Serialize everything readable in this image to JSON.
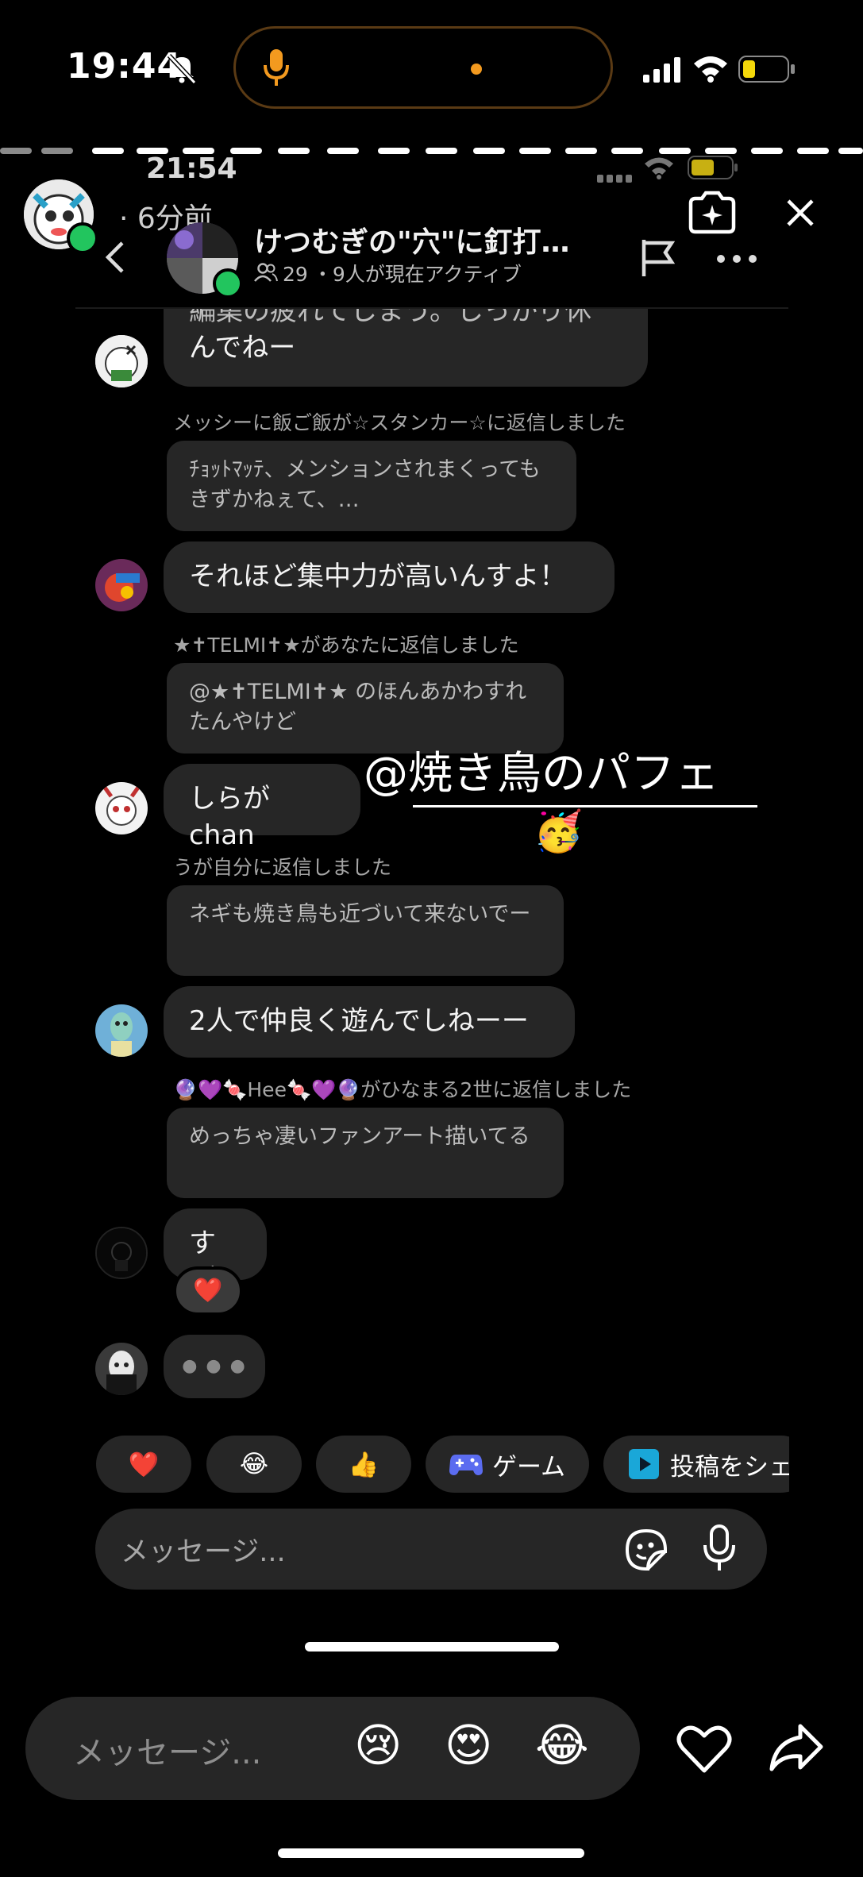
{
  "status_bar": {
    "time": "19:44"
  },
  "inner_status": {
    "time": "21:54"
  },
  "story": {
    "time_ago": "· 6分前"
  },
  "chat_header": {
    "title": "けつむぎの\"穴\"に釘打…",
    "members": "29",
    "active": "・9人が現在アクティブ"
  },
  "messages": {
    "m0": {
      "text_line1": "編集の疲れてしまう。しっかり休",
      "text_line2": "んでねー"
    },
    "r1": {
      "note": "メッシーに飯ご飯が☆スタンカー☆に返信しました",
      "quote": "ﾁｮｯﾄﾏｯﾃ、メンションされまくってもきずかねぇて、…"
    },
    "m1": {
      "text": "それほど集中力が高いんすよ！"
    },
    "r2": {
      "note": "★✝TELMI✝★があなたに返信しました",
      "quote": "@★✝TELMI✝★ のほんあかわすれたんやけど"
    },
    "m2": {
      "text": "しらがchan"
    },
    "r3": {
      "note": "うが自分に返信しました",
      "quote": "ネギも焼き鳥も近づいて来ないでー"
    },
    "m3": {
      "text": "2人で仲良く遊んでしねーー"
    },
    "r4": {
      "note": "🔮💜🍬Hee🍬💜🔮がひなまる2世に返信しました",
      "quote": "めっちゃ凄いファンアート描いてる"
    },
    "m4": {
      "text": "すご",
      "reaction": "❤️"
    },
    "typing": {
      "dots": "● ● ●"
    }
  },
  "sticker": {
    "mention": "@焼き鳥のパフェ",
    "emoji": "🥳"
  },
  "quick_replies": [
    {
      "label": "❤️"
    },
    {
      "label": "😂"
    },
    {
      "label": "👍"
    },
    {
      "label": "ゲーム"
    },
    {
      "label": "投稿をシェ"
    }
  ],
  "chat_input": {
    "placeholder": "メッセージ..."
  },
  "story_reply": {
    "placeholder": "メッセージ...",
    "emojis": [
      "😢",
      "😍",
      "😂"
    ]
  },
  "colors": {
    "online": "#22c55e",
    "bubble": "#262626",
    "accent": "#f39a1f"
  }
}
